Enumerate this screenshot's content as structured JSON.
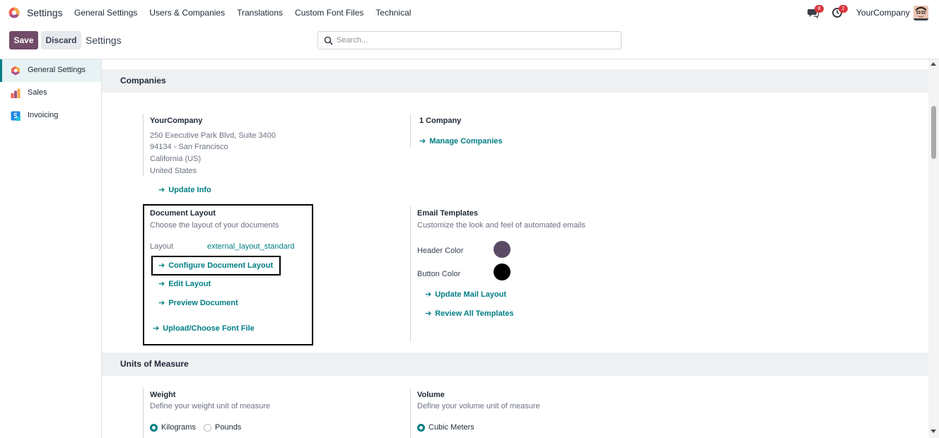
{
  "navbar": {
    "app_title": "Settings",
    "menu": [
      "General Settings",
      "Users & Companies",
      "Translations",
      "Custom Font Files",
      "Technical"
    ],
    "chat_badge": "8",
    "activity_badge": "2",
    "company": "YourCompany"
  },
  "control_panel": {
    "save_label": "Save",
    "discard_label": "Discard",
    "breadcrumb": "Settings",
    "search_placeholder": "Search..."
  },
  "sidebar": {
    "items": [
      {
        "label": "General Settings",
        "icon": "odoo-logo-icon",
        "active": true
      },
      {
        "label": "Sales",
        "icon": "sales-chart-icon",
        "active": false
      },
      {
        "label": "Invoicing",
        "icon": "invoicing-icon",
        "active": false
      }
    ]
  },
  "companies": {
    "header": "Companies",
    "company_name": "YourCompany",
    "address": [
      "250 Executive Park Blvd, Suite 3400",
      "94134 - San Francisco",
      "California (US)",
      "United States"
    ],
    "update_info": "Update Info",
    "count": "1 Company",
    "manage_companies": "Manage Companies",
    "document_layout": {
      "title": "Document Layout",
      "desc": "Choose the layout of your documents",
      "layout_label": "Layout",
      "layout_value": "external_layout_standard",
      "configure": "Configure Document Layout",
      "edit": "Edit Layout",
      "preview": "Preview Document",
      "upload_font": "Upload/Choose Font File"
    },
    "email_templates": {
      "title": "Email Templates",
      "desc": "Customize the look and feel of automated emails",
      "header_color_label": "Header Color",
      "header_color": "#5a4a66",
      "button_color_label": "Button Color",
      "button_color": "#000000",
      "update_mail": "Update Mail Layout",
      "review_all": "Review All Templates"
    }
  },
  "units": {
    "header": "Units of Measure",
    "weight": {
      "title": "Weight",
      "desc": "Define your weight unit of measure",
      "options": [
        "Kilograms",
        "Pounds"
      ],
      "selected": "Kilograms"
    },
    "volume": {
      "title": "Volume",
      "desc": "Define your volume unit of measure",
      "options": [
        "Cubic Meters"
      ],
      "selected": "Cubic Meters"
    }
  },
  "colors": {
    "brand": "#714b67",
    "accent": "#017e84"
  }
}
